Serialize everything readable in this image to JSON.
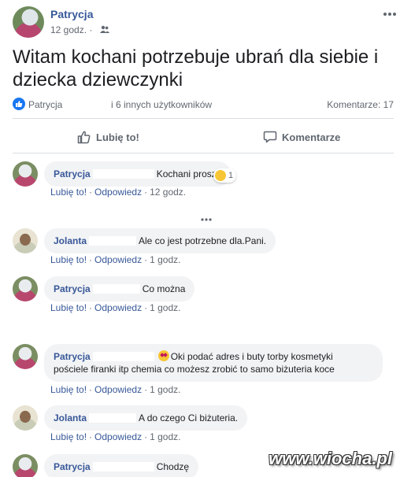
{
  "post": {
    "author": "Patrycja",
    "time": "12 godz. ·",
    "text": "Witam kochani potrzebuje ubrań dla siebie i dziecka dziewczynki"
  },
  "reactions": {
    "name": "Patrycja",
    "others": "i 6 innych użytkowników",
    "comments": "Komentarze: 17"
  },
  "actions": {
    "like": "Lubię to!",
    "comment": "Komentarze"
  },
  "comment_links": {
    "like": "Lubię to!",
    "reply": "Odpowiedz"
  },
  "comments": [
    {
      "name": "Patrycja",
      "text": "Kochani proszę",
      "time": "12 godz.",
      "reaction_count": "1"
    },
    {
      "name": "Jolanta",
      "text": "Ale co jest potrzebne dla.Pani.",
      "time": "1 godz."
    },
    {
      "name": "Patrycja",
      "text": "Co można",
      "time": "1 godz."
    },
    {
      "name": "Patrycja",
      "text_line1": "Oki podać adres i buty torby kosmetyki",
      "text_line2": "pościele firanki itp chemia co możesz zrobić to samo biżuteria koce",
      "time": "1 godz."
    },
    {
      "name": "Jolanta",
      "text": "A do czego Ci biżuteria.",
      "time": "1 godz."
    },
    {
      "name": "Patrycja",
      "text": "Chodzę"
    }
  ],
  "watermark": "www.wiocha.pl",
  "colors": {
    "link_blue": "#385898",
    "fb_blue": "#1877f2",
    "bubble_gray": "#f2f3f5",
    "meta_gray": "#606770"
  }
}
